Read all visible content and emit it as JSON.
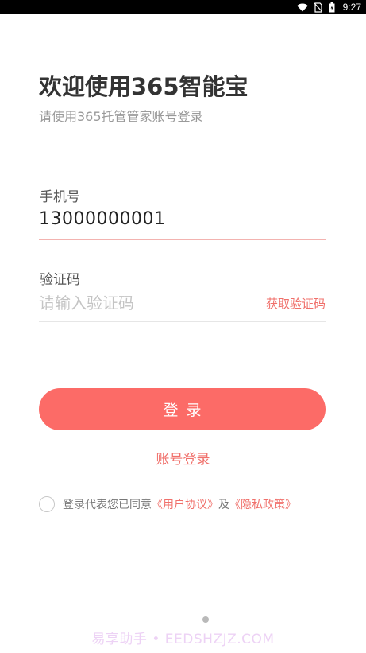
{
  "status_bar": {
    "time": "9:27",
    "icons": [
      "wifi-icon",
      "no-sim-icon",
      "battery-icon"
    ]
  },
  "header": {
    "title": "欢迎使用365智能宝",
    "subtitle": "请使用365托管管家账号登录"
  },
  "form": {
    "phone_label": "手机号",
    "phone_value": "13000000001",
    "code_label": "验证码",
    "code_placeholder": "请输入验证码",
    "get_code_label": "获取验证码"
  },
  "actions": {
    "login_label": "登录",
    "account_login_label": "账号登录"
  },
  "agreement": {
    "checked": false,
    "prefix": "登录代表您已同意",
    "user_agreement": "《用户协议》",
    "conjunction": "及",
    "privacy_policy": "《隐私政策》"
  },
  "watermark": {
    "text": "易享助手 • EEDSHZJZ.COM"
  },
  "colors": {
    "accent": "#fc6b67",
    "link": "#f0706b",
    "status_bar": "#000000"
  }
}
